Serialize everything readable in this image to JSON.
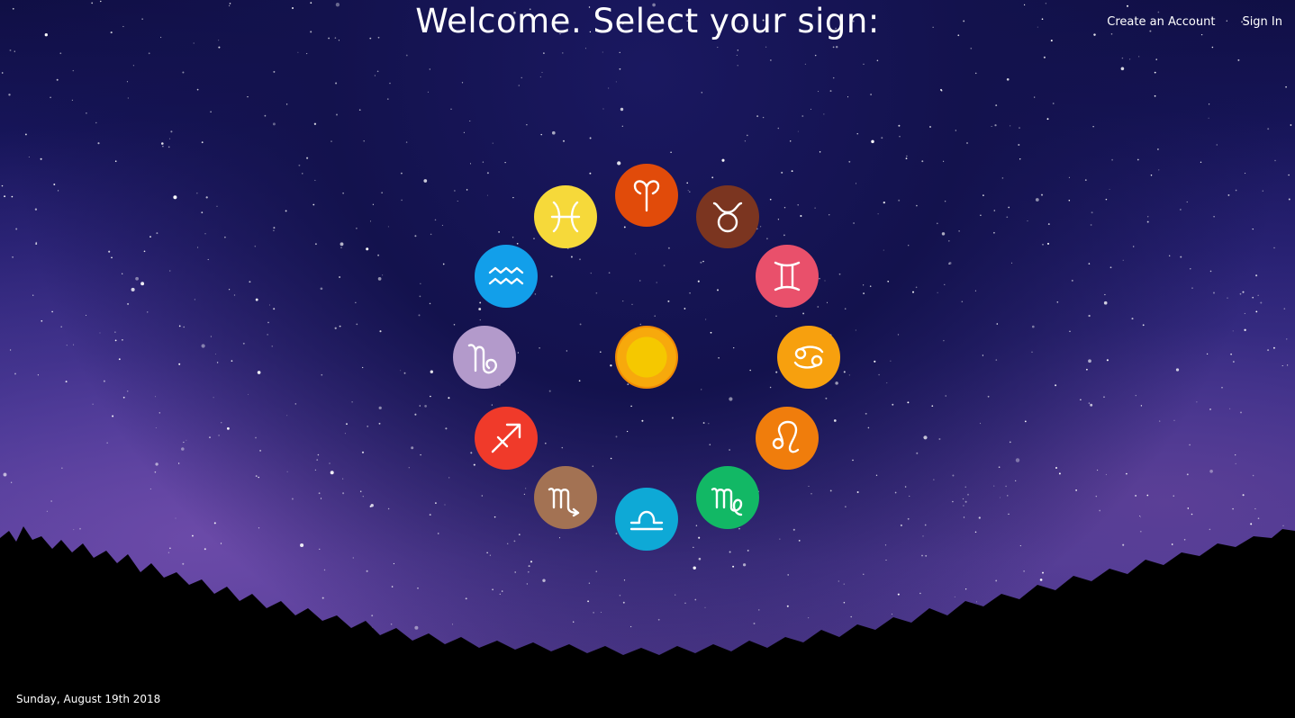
{
  "header": {
    "title": "Welcome. Select your sign:"
  },
  "nav": {
    "create_account": "Create an Account",
    "sign_in": "Sign In"
  },
  "footer": {
    "date": "Sunday, August 19th 2018"
  },
  "center": {
    "icon": "sun-icon",
    "colors": {
      "outer": "#f08a05",
      "middle": "#f7a90c",
      "inner": "#f5c800"
    }
  },
  "signs": [
    {
      "name": "aries",
      "icon": "aries-icon",
      "color": "#e14b0a"
    },
    {
      "name": "taurus",
      "icon": "taurus-icon",
      "color": "#7b3520"
    },
    {
      "name": "gemini",
      "icon": "gemini-icon",
      "color": "#e9506b"
    },
    {
      "name": "cancer",
      "icon": "cancer-icon",
      "color": "#f7a00e"
    },
    {
      "name": "leo",
      "icon": "leo-icon",
      "color": "#f07d0c"
    },
    {
      "name": "virgo",
      "icon": "virgo-icon",
      "color": "#12b865"
    },
    {
      "name": "libra",
      "icon": "libra-icon",
      "color": "#0ea9d6"
    },
    {
      "name": "scorpio",
      "icon": "scorpio-icon",
      "color": "#a37253"
    },
    {
      "name": "sagittarius",
      "icon": "sagittarius-icon",
      "color": "#f03a2a"
    },
    {
      "name": "capricorn",
      "icon": "capricorn-icon",
      "color": "#b39acb"
    },
    {
      "name": "aquarius",
      "icon": "aquarius-icon",
      "color": "#129fea"
    },
    {
      "name": "pisces",
      "icon": "pisces-icon",
      "color": "#f6d93a"
    }
  ]
}
